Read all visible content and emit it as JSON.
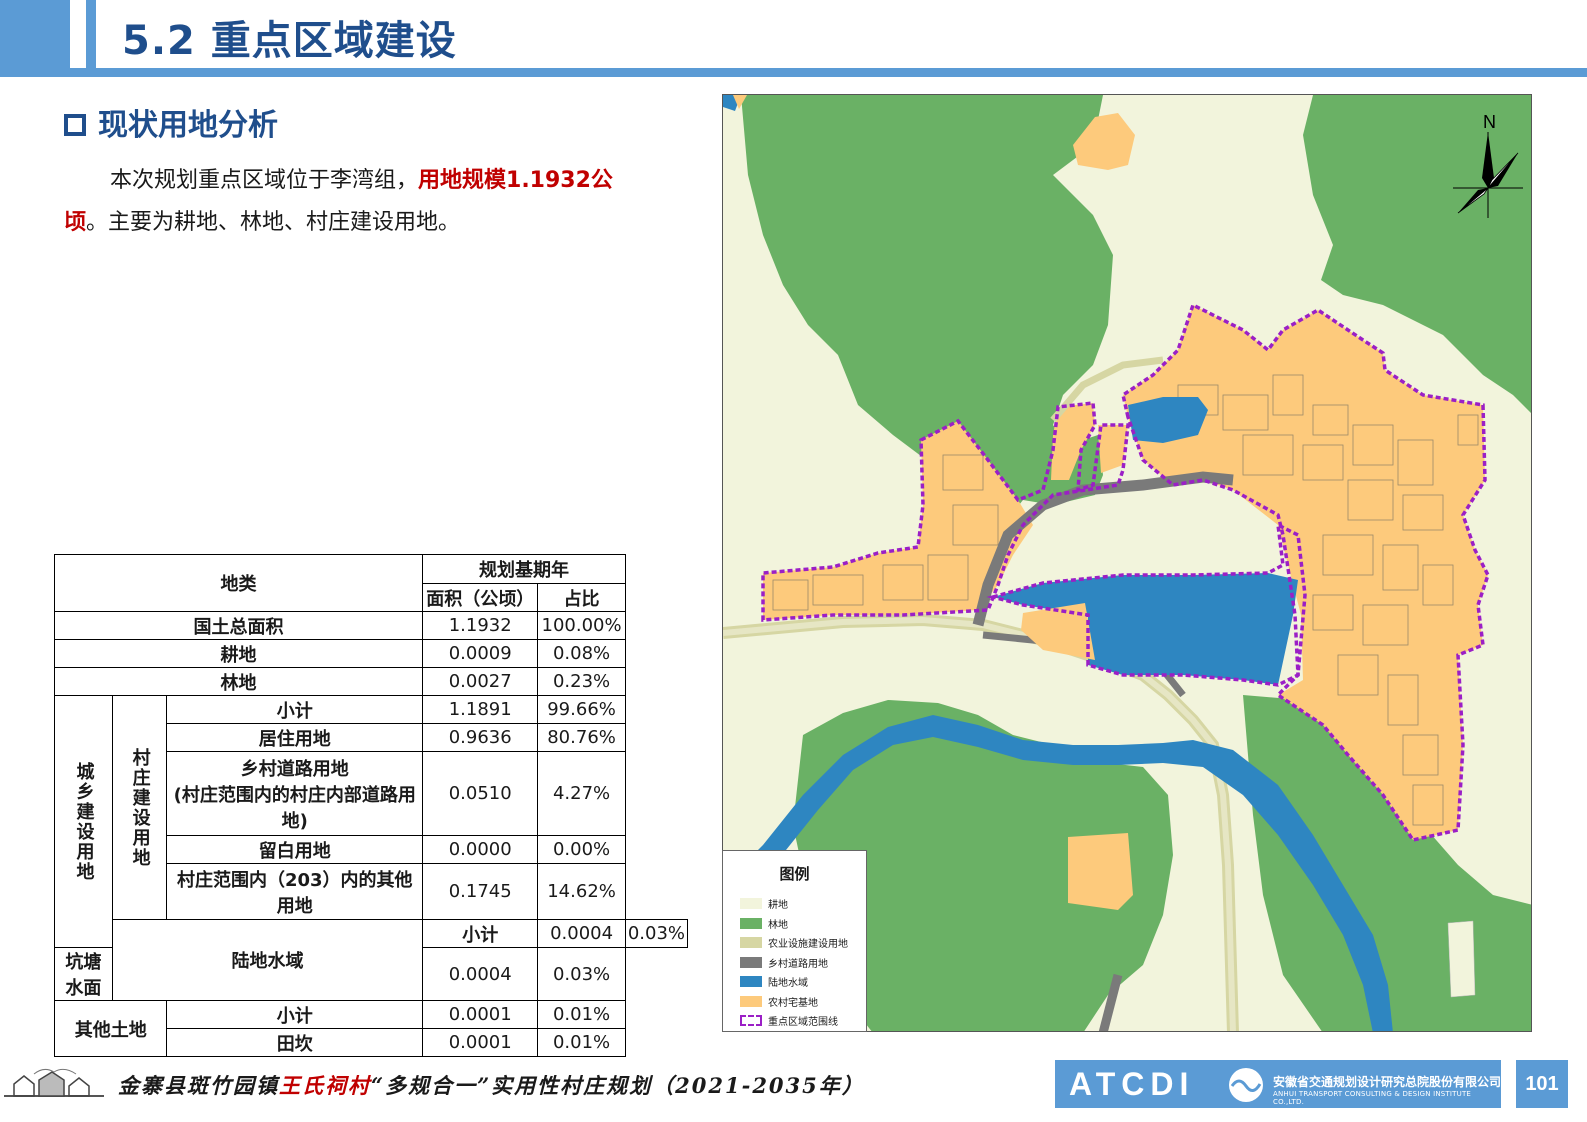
{
  "header": {
    "title": "5.2 重点区域建设"
  },
  "section": {
    "title": "现状用地分析"
  },
  "intro": {
    "text_before": "本次规划重点区域位于李湾组，",
    "highlight": "用地规模1.1932公顷",
    "text_after": "。主要为耕地、林地、村庄建设用地。"
  },
  "table": {
    "header_land_type": "地类",
    "header_base_year": "规划基期年",
    "header_area": "面积（公顷）",
    "header_ratio": "占比",
    "group_urban_rural": "城乡建设用地",
    "group_village": "村庄建设用地",
    "group_water": "陆地水域",
    "group_other": "其他土地",
    "rows": [
      {
        "name": "国土总面积",
        "area": "1.1932",
        "ratio": "100.00%"
      },
      {
        "name": "耕地",
        "area": "0.0009",
        "ratio": "0.08%"
      },
      {
        "name": "林地",
        "area": "0.0027",
        "ratio": "0.23%"
      },
      {
        "name": "小计",
        "area": "1.1891",
        "ratio": "99.66%"
      },
      {
        "name": "居住用地",
        "area": "0.9636",
        "ratio": "80.76%"
      },
      {
        "name": "乡村道路用地",
        "name2": "(村庄范围内的村庄内部道路用地)",
        "area": "0.0510",
        "ratio": "4.27%"
      },
      {
        "name": "留白用地",
        "area": "0.0000",
        "ratio": "0.00%"
      },
      {
        "name": "村庄范围内（203）内的其他用地",
        "area": "0.1745",
        "ratio": "14.62%"
      },
      {
        "name": "小计",
        "area": "0.0004",
        "ratio": "0.03%"
      },
      {
        "name": "坑塘水面",
        "area": "0.0004",
        "ratio": "0.03%"
      },
      {
        "name": "小计",
        "area": "0.0001",
        "ratio": "0.01%"
      },
      {
        "name": "田坎",
        "area": "0.0001",
        "ratio": "0.01%"
      }
    ]
  },
  "map": {
    "north_label": "N",
    "legend": {
      "title": "图例",
      "items": [
        {
          "label": "耕地",
          "color": "#f2f4dc"
        },
        {
          "label": "林地",
          "color": "#6ab165"
        },
        {
          "label": "农业设施建设用地",
          "color": "#d6d6a3"
        },
        {
          "label": "乡村道路用地",
          "color": "#7a7a7a"
        },
        {
          "label": "陆地水域",
          "color": "#2e86c1"
        },
        {
          "label": "农村宅基地",
          "color": "#fdca7c"
        },
        {
          "label": "重点区域范围线",
          "color": "#9b1fc6"
        }
      ]
    }
  },
  "footer": {
    "text_before": "金寨县斑竹园镇",
    "village": "王氏祠村",
    "text_after": "“多规合一”实用性村庄规划（2021-2035年）",
    "logo_acronym": "ATCDI",
    "company_name": "安徽省交通规划设计研究总院股份有限公司",
    "company_en": "ANHUI TRANSPORT CONSULTING & DESIGN INSTITUTE CO.,LTD.",
    "page_number": "101"
  }
}
